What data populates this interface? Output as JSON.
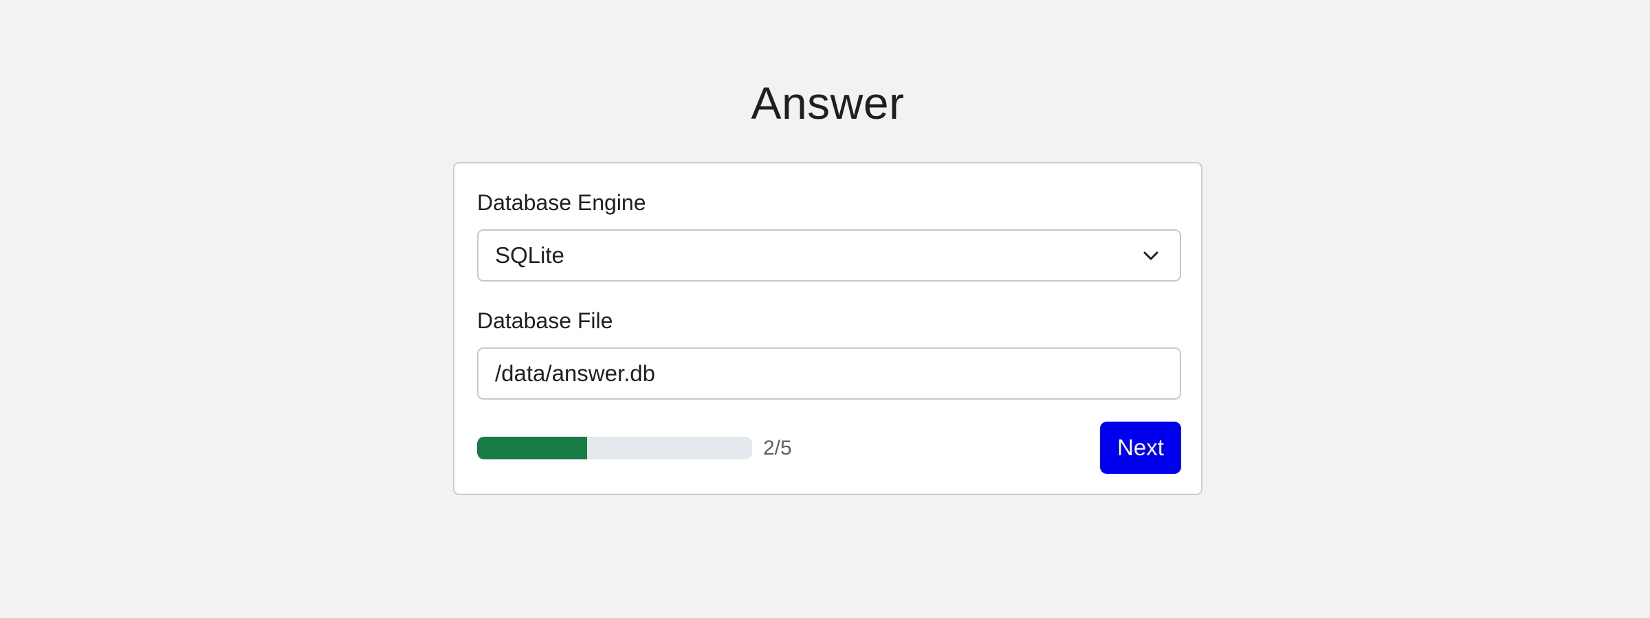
{
  "page": {
    "title": "Answer"
  },
  "form": {
    "engine_label": "Database Engine",
    "engine_value": "SQLite",
    "file_label": "Database File",
    "file_value": "/data/answer.db",
    "progress": {
      "current": 2,
      "total": 5,
      "text": "2/5"
    },
    "next_label": "Next"
  },
  "colors": {
    "background": "#f2f2f2",
    "card": "#ffffff",
    "progress_fill": "#1a7a44",
    "progress_track": "#e5e8ec",
    "button": "#0000ee",
    "button_text": "#ffffff"
  },
  "icons": {
    "select_chevron": "chevron-down-icon"
  }
}
